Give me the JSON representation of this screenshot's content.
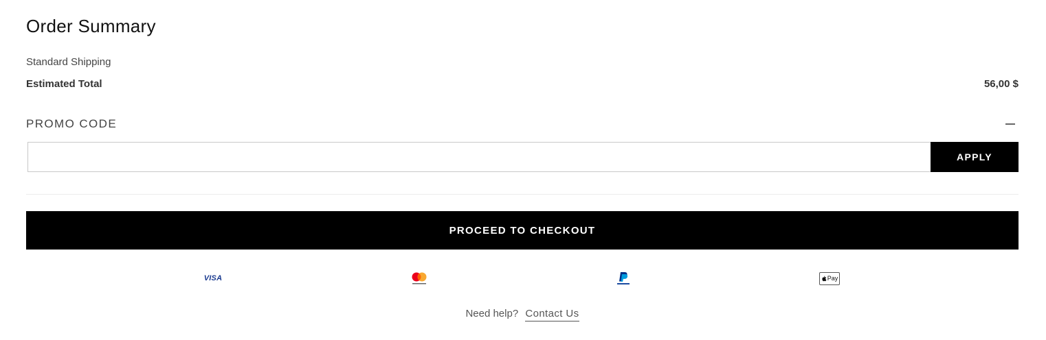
{
  "order_summary": {
    "title": "Order Summary",
    "shipping_label": "Standard Shipping",
    "total_label": "Estimated Total",
    "total_value": "56,00 $"
  },
  "promo": {
    "label": "PROMO CODE",
    "toggle_icon": "minus-icon",
    "input_value": "",
    "input_placeholder": "",
    "apply_label": "APPLY"
  },
  "checkout": {
    "label": "PROCEED TO CHECKOUT"
  },
  "payment_methods": [
    {
      "name": "visa-icon",
      "text": "VISA",
      "color": "#1a3a8f"
    },
    {
      "name": "mastercard-icon",
      "text": "mastercard",
      "colors": [
        "#eb001b",
        "#f79e1b"
      ]
    },
    {
      "name": "paypal-icon",
      "text": "PayPal",
      "colors": [
        "#003087",
        "#009cde"
      ]
    },
    {
      "name": "apple-pay-icon",
      "text": "Pay"
    }
  ],
  "help": {
    "text": "Need help?",
    "link_label": "Contact Us"
  }
}
